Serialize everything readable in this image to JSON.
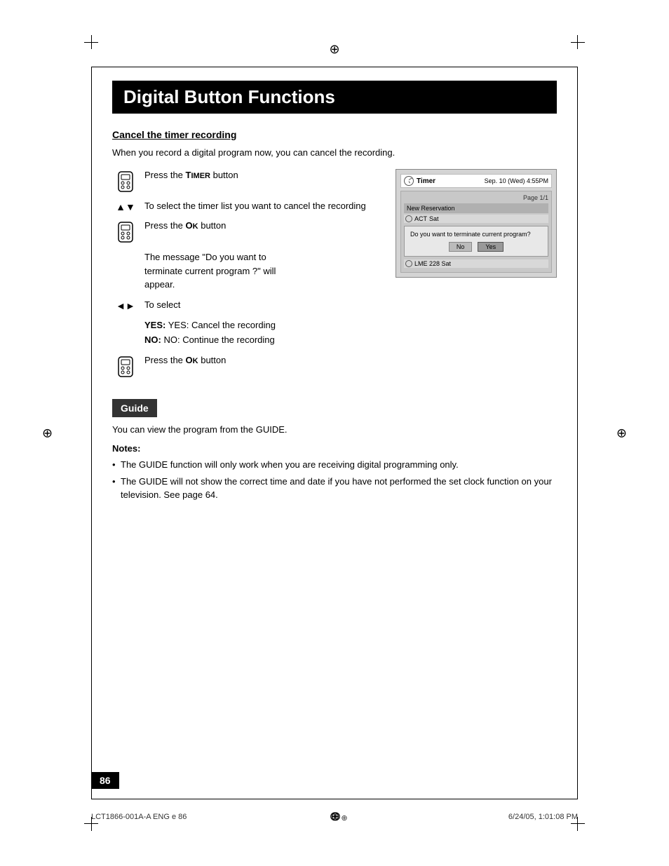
{
  "page": {
    "title": "Digital Button Functions",
    "number": "86",
    "footer_left": "LCT1866-001A-A ENG e  86",
    "footer_right": "6/24/05, 1:01:08 PM"
  },
  "section1": {
    "heading": "Cancel the timer recording",
    "intro": "When you record a digital program now, you can cancel the recording.",
    "steps": [
      {
        "type": "remote",
        "text": "Press the TIMER button"
      },
      {
        "type": "arrows_updown",
        "text": "To select the timer list you want to cancel the recording"
      },
      {
        "type": "remote",
        "text": "Press the OK button"
      },
      {
        "type": "submessage",
        "text": "The message \"Do you want to terminate current program ?\" will appear."
      },
      {
        "type": "arrows_leftright",
        "text": "To select"
      },
      {
        "type": "yesno",
        "yes_text": "YES:  Cancel the recording",
        "no_text": "NO:  Continue the recording"
      },
      {
        "type": "remote",
        "text": "Press the OK button"
      }
    ]
  },
  "screenshot": {
    "header_label": "Timer",
    "header_date": "Sep. 10 (Wed)  4:55PM",
    "page_label": "Page 1/1",
    "table_header": "New Reservation",
    "row1_icon": true,
    "row1_text": "ACT  Sat",
    "row2_icon": true,
    "row2_text": "LME  228  Sat",
    "dialog_message": "Do you want to terminate current program?",
    "btn_no": "No",
    "btn_yes": "Yes"
  },
  "section2": {
    "heading": "Guide",
    "text": "You can view the program from the GUIDE.",
    "notes_heading": "Notes:",
    "notes": [
      "The GUIDE function will only work when you are receiving digital programming only.",
      "The GUIDE will not show the correct time and date if you have not performed the set clock function on your television.  See page 64."
    ]
  }
}
